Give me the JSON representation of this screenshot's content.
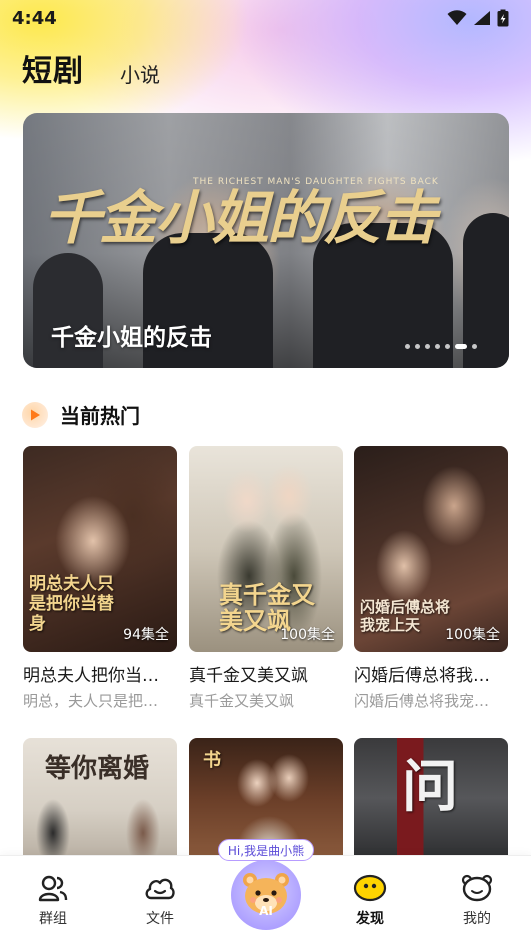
{
  "status_bar": {
    "time": "4:44"
  },
  "header": {
    "tab_active": "短剧",
    "tab_inactive": "小说"
  },
  "banner": {
    "art_title": "千金小姐的反击",
    "art_subtitle_en": "THE RICHEST MAN'S DAUGHTER FIGHTS BACK",
    "title": "千金小姐的反击",
    "dot_count": 7,
    "active_dot": 5
  },
  "section": {
    "title": "当前热门"
  },
  "cards": [
    {
      "title": "明总夫人把你当…",
      "desc": "明总，夫人只是把…",
      "episodes": "94集全",
      "poster_text": "明总夫人只是把你当替身"
    },
    {
      "title": "真千金又美又飒",
      "desc": "真千金又美又飒",
      "episodes": "100集全",
      "poster_text": "真千金又美又飒"
    },
    {
      "title": "闪婚后傅总将我…",
      "desc": "闪婚后傅总将我宠…",
      "episodes": "100集全",
      "poster_text": "闪婚后傅总将我宠上天"
    }
  ],
  "cards_row2": [
    {
      "poster_text": "等你离婚"
    },
    {
      "poster_text": "书"
    },
    {
      "poster_text": "问"
    }
  ],
  "ai": {
    "bubble": "Hi,我是曲小熊",
    "label": "AI"
  },
  "nav": {
    "groups": "群组",
    "files": "文件",
    "discover": "发现",
    "mine": "我的"
  },
  "colors": {
    "accent": "#ffcc00",
    "ai_purple": "#b4a8ff",
    "badge_orange": "#ff7a1a"
  }
}
